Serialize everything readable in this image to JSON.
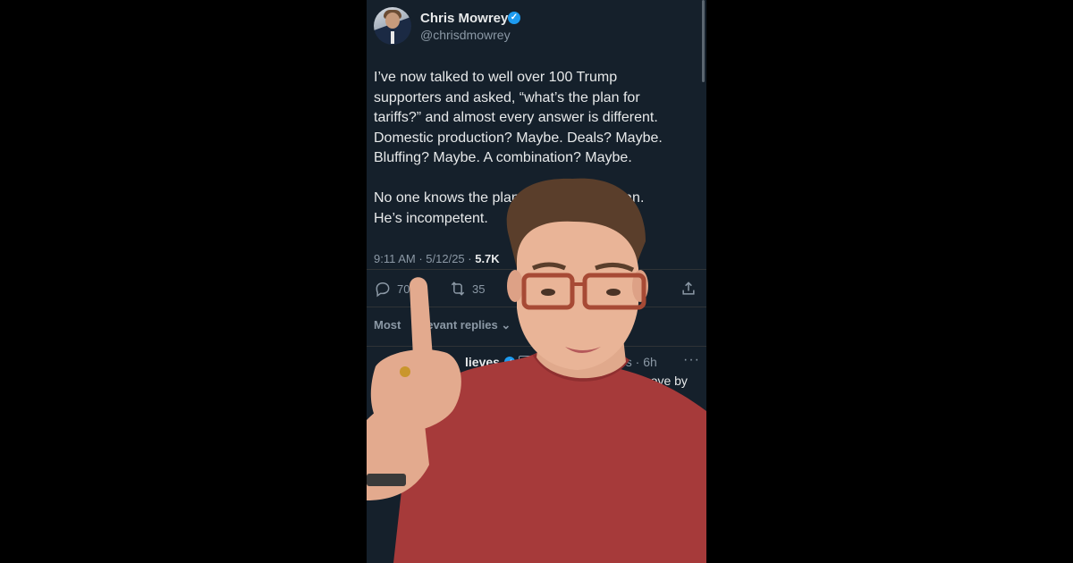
{
  "author": {
    "name": "Chris Mowrey",
    "handle": "@chrisdmowrey"
  },
  "tweet": {
    "text": "I’ve now talked to well over 100 Trump\nsupporters and asked, “what’s the plan for\ntariffs?” and almost every answer is different.\nDomestic production? Maybe. Deals? Maybe.\nBluffing? Maybe. A combination? Maybe.\n\nNo one knows the plan               is no plan.\nHe’s incompetent.",
    "time": "9:11 AM · 5/12/25 · ",
    "views": "5.7K"
  },
  "actions": {
    "replies": "70",
    "reposts": "35"
  },
  "replies_sort": {
    "label": "Most        evant replies"
  },
  "reply": {
    "name": "lieves",
    "badge": "GB",
    "time": "es · 6h",
    "more": "···",
    "text": "move by"
  },
  "colors": {
    "background": "#15202b",
    "text": "#e7e9ea",
    "muted": "#8b98a5",
    "verified": "#1d9bf0",
    "shirt": "#a63a3a"
  },
  "icons": [
    "verified-badge-icon",
    "reply-icon",
    "repost-icon",
    "share-icon",
    "chevron-down-icon",
    "more-icon"
  ]
}
